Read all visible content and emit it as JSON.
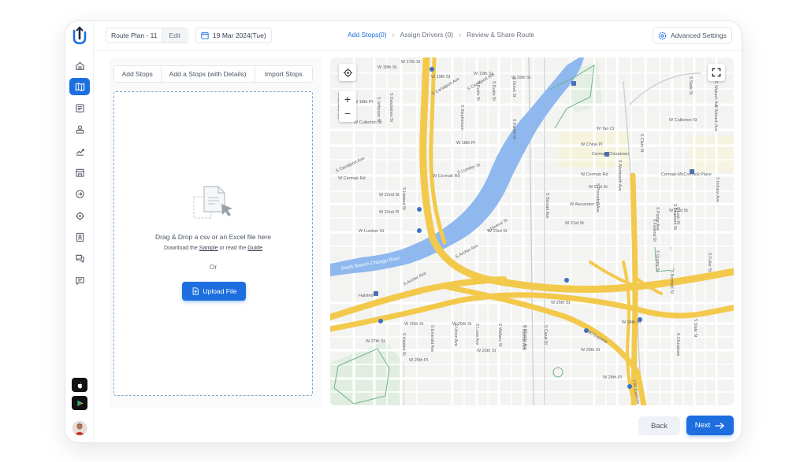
{
  "header": {
    "plan_name": "Route Plan - 11",
    "edit_label": "Edit",
    "date": "19 Mar 2024(Tue)",
    "steps": [
      {
        "label": "Add Stops(0)",
        "active": true
      },
      {
        "label": "Assign Drivers (0)",
        "active": false
      },
      {
        "label": "Review & Share Route",
        "active": false
      }
    ],
    "advanced_settings": "Advanced Settings"
  },
  "sidebar": {
    "items": [
      {
        "icon": "home-icon"
      },
      {
        "icon": "route-map-icon",
        "active": true
      },
      {
        "icon": "checklist-icon"
      },
      {
        "icon": "drivers-icon"
      },
      {
        "icon": "analytics-icon"
      },
      {
        "icon": "store-icon"
      },
      {
        "icon": "integration-icon"
      },
      {
        "icon": "location-target-icon"
      },
      {
        "icon": "contacts-icon"
      },
      {
        "icon": "support-icon"
      },
      {
        "icon": "messages-icon"
      }
    ],
    "app_store": "apple-store-icon",
    "play_store": "google-play-icon"
  },
  "stops_panel": {
    "tabs": [
      "Add Stops",
      "Add a Stops (with Details)",
      "Import Stops"
    ],
    "drop_title": "Drag & Drop a csv or an Excel file here",
    "drop_sub_prefix": "Download the",
    "sample_link": "Sample",
    "drop_sub_middle": "or read the",
    "guide_link": "Guide",
    "or_text": "Or",
    "upload_label": "Upload File"
  },
  "map": {
    "zoom_in": "+",
    "zoom_out": "−",
    "labels": {
      "w17th": "W 17th St",
      "w18th": "W 18th St",
      "w19th": "W 19th St",
      "w19th_b": "W 19th St",
      "w19th_c": "W 19th St",
      "w18th_pl": "W 18th Pl",
      "w18th_pl_b": "W 18th Pl",
      "w21st": "W 21st St",
      "w21st_b": "W 21st St",
      "w21st_c": "W 21st St",
      "w22nd": "W 22nd St",
      "w22nd_pl": "W 22nd Pl",
      "w23rd": "W 23rd St",
      "w24th": "W 24th St",
      "w25th": "W 25th Pl",
      "w26th": "W 26th St",
      "w26th_b": "W 26th St",
      "w27th": "W 27th St",
      "w28th": "W 28th St",
      "w28th_b": "W 28th Pl",
      "w25th_st": "W 25th St",
      "cermak_rd": "W Cermak Rd",
      "cermak_rd_b": "W Cermak Rd",
      "cermak_rd_c": "W Cermak Rd",
      "canalport": "S Canalport Ave",
      "canalport_b": "S Canalport Ave",
      "cullerton": "W Cullerton St",
      "cullerton_b": "W Cullerton St",
      "archer": "S Archer Ave",
      "archer_b": "S Archer Ave",
      "lumber": "S Lumber St",
      "lumber_b": "S Lumber St",
      "lumber_c": "W Lumber St",
      "alexander": "W Alexander St",
      "tan": "W Tan Ct",
      "china": "W China Pl",
      "halsted": "S Halsted St",
      "halsted_b": "S Halsted St",
      "halsted_stop": "Halsted",
      "state": "S State St",
      "state_b": "S State St",
      "wabash": "S Wabash Ave",
      "wabash_b": "S Wabash Ave",
      "indiana": "S Indiana Ave",
      "dearborn": "S Dearborn St",
      "federal": "S Federal St",
      "clark": "S Clark St",
      "wentworth": "S Wentworth Ave",
      "princeton": "S Princeton Ave",
      "stewart": "S Stewart Ave",
      "normal": "S Normal Ave",
      "union": "S Union Ave",
      "lowe": "S Lowe Ave",
      "wallace": "S Wallace St",
      "emerald": "S Emerald Ave",
      "river": "South Branch Chicago River",
      "cermak_chinatown": "Cermak-Chinatown",
      "cermak_mccormick": "Cermak-McCormick Place",
      "i90": "I-90 Express",
      "i90_b": "I-90 Express",
      "ruble": "S Ruble St",
      "ruble_b": "S Ruble St",
      "stephenson": "S Stephenson",
      "jefferson": "S Jefferson St",
      "desplaines": "S Desplaines St",
      "grove": "S Grove St",
      "eleanor": "S Eleanor St",
      "farrell": "S Farrell St",
      "bonfield": "S Bonfield St",
      "lock": "S Lock St",
      "quarry": "S Quarry St",
      "poplar": "S Poplar Ave",
      "canal": "S Canal St",
      "shields": "S Shields Ave",
      "fuller": "S Fuller St",
      "ashland": "S Ashland Ave",
      "chinatown": "S Chinatown"
    }
  },
  "footer": {
    "back_label": "Back",
    "next_label": "Next"
  },
  "colors": {
    "accent": "#1d6fe0",
    "highway": "#f3c94c",
    "river": "#8fb8ef",
    "park": "#cfe6d0"
  }
}
